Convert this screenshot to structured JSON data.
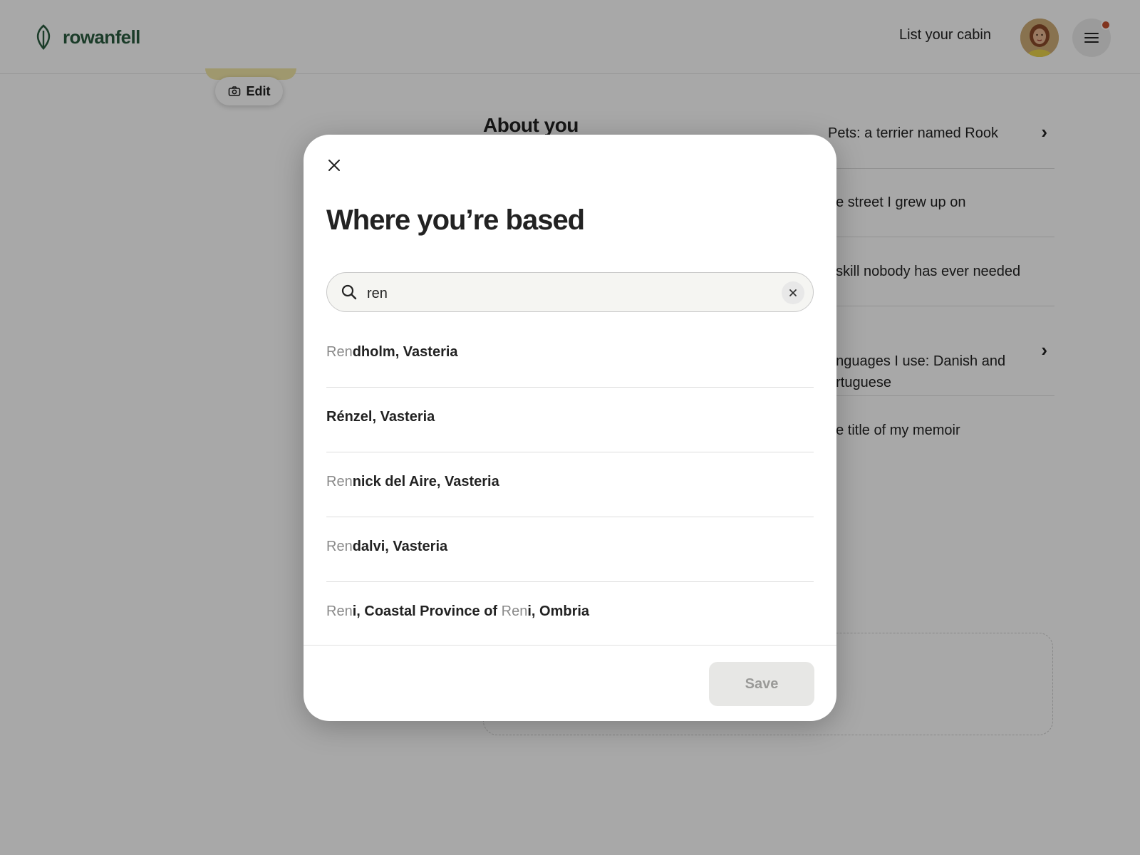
{
  "header": {
    "brand": "rowanfell",
    "list_cabin": "List your cabin",
    "menu_icon": "hamburger-menu-icon",
    "avatar_icon": "avatar"
  },
  "profile": {
    "edit_label": "Edit",
    "about_title": "About you",
    "items": [
      "Pets: a terrier named Rook",
      "he street I grew up on",
      ". skill nobody has ever needed",
      "anguages I use: Danish and\nortuguese",
      "he title of my memoir"
    ]
  },
  "modal": {
    "title": "Where you’re based",
    "search": {
      "value": "ren",
      "icon": "search-icon",
      "clear_icon": "close-icon"
    },
    "results": [
      [
        {
          "t": "Ren",
          "m": true
        },
        {
          "t": "dholm, Vasteria",
          "m": false
        }
      ],
      [
        {
          "t": "Rénzel, Vasteria",
          "m": false
        }
      ],
      [
        {
          "t": "Ren",
          "m": true
        },
        {
          "t": "nick del Aire, Vasteria",
          "m": false
        }
      ],
      [
        {
          "t": "Ren",
          "m": true
        },
        {
          "t": "dalvi, Vasteria",
          "m": false
        }
      ],
      [
        {
          "t": "Ren",
          "m": true
        },
        {
          "t": "i, Coastal Province of ",
          "m": false
        },
        {
          "t": "Ren",
          "m": true
        },
        {
          "t": "i, Ombria",
          "m": false
        }
      ]
    ],
    "save_label": "Save"
  },
  "colors": {
    "brand": "#2a5b3f",
    "notification": "#c4502f",
    "overlay": "rgba(0,0,0,0.34)"
  }
}
